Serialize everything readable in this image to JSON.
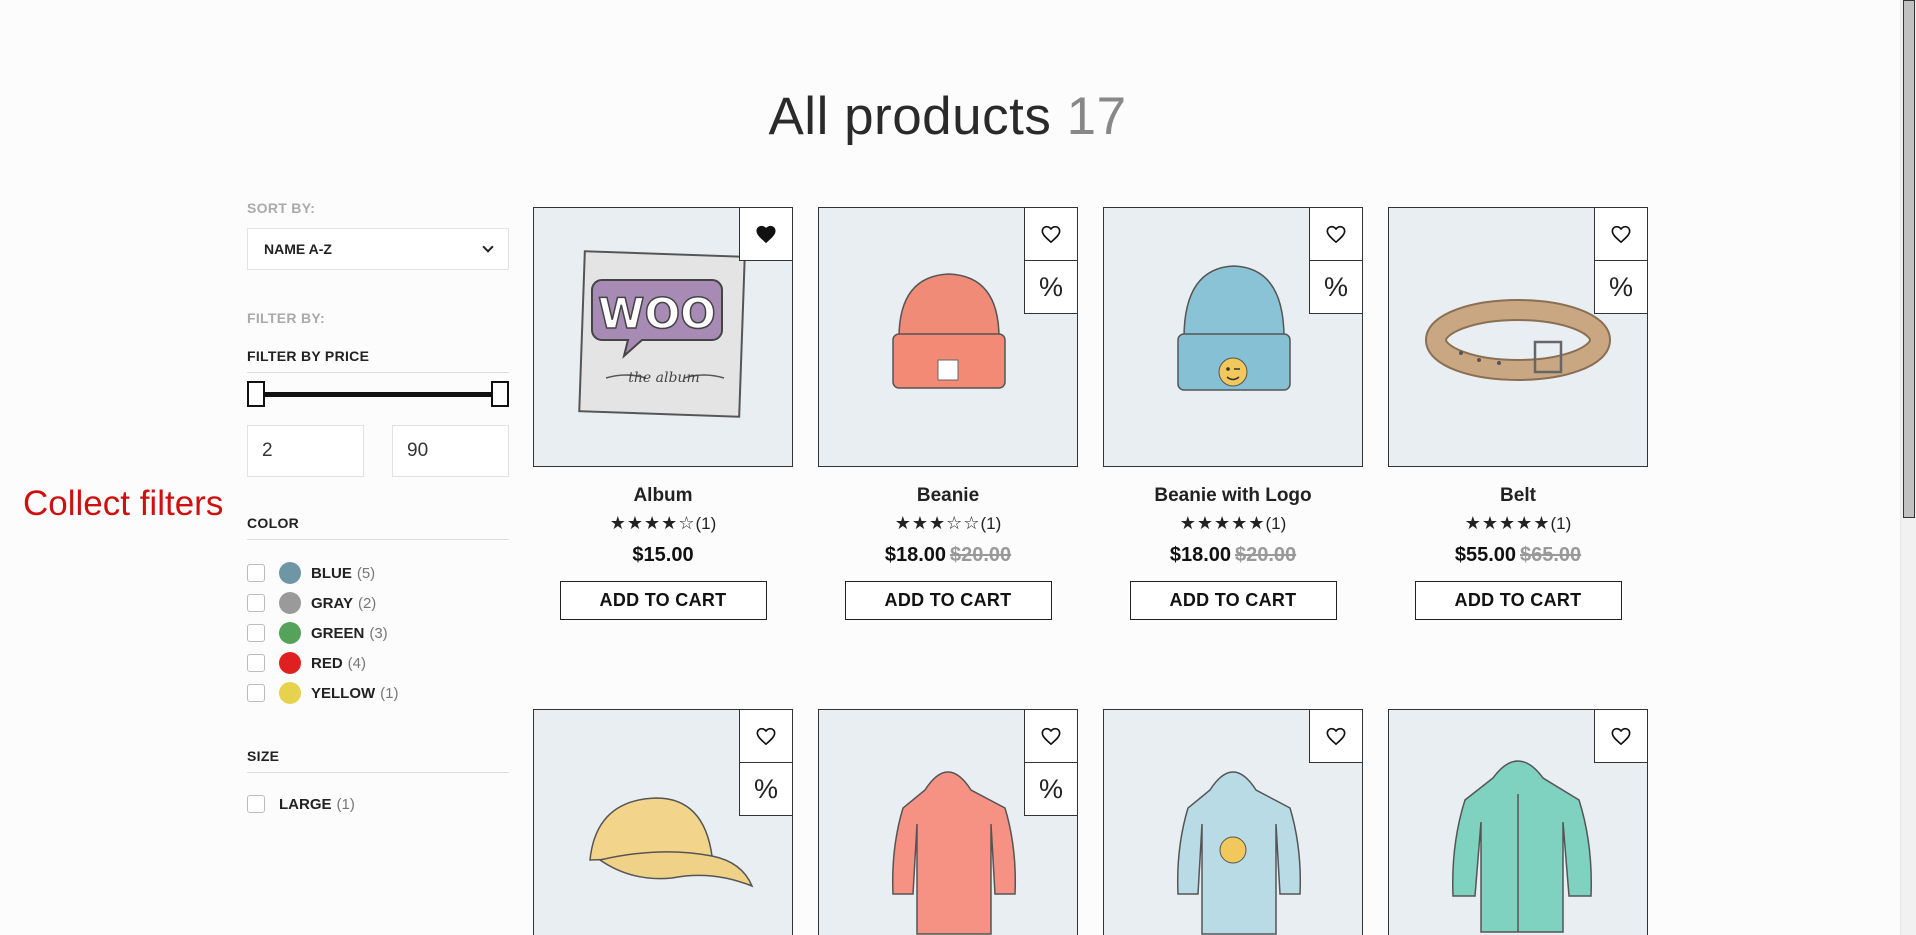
{
  "header": {
    "title": "All products",
    "count": "17"
  },
  "annotation": "Collect filters",
  "sidebar": {
    "sort_label": "SORT BY:",
    "sort_value": "NAME A-Z",
    "filter_label": "FILTER BY:",
    "price_title": "FILTER BY PRICE",
    "price_min": "2",
    "price_max": "90",
    "color_title": "COLOR",
    "colors": [
      {
        "name": "BLUE",
        "count": "(5)",
        "hex": "#6f96a4"
      },
      {
        "name": "GRAY",
        "count": "(2)",
        "hex": "#9a9a9a"
      },
      {
        "name": "GREEN",
        "count": "(3)",
        "hex": "#55a35a"
      },
      {
        "name": "RED",
        "count": "(4)",
        "hex": "#e02020"
      },
      {
        "name": "YELLOW",
        "count": "(1)",
        "hex": "#e6d24d"
      }
    ],
    "size_title": "SIZE",
    "sizes": [
      {
        "name": "LARGE",
        "count": "(1)"
      }
    ]
  },
  "products": [
    {
      "name": "Album",
      "stars": "★★★★☆",
      "rating_count": "(1)",
      "price": "$15.00",
      "old_price": "",
      "add_label": "ADD TO CART",
      "wishlisted": true,
      "on_sale": false
    },
    {
      "name": "Beanie",
      "stars": "★★★☆☆",
      "rating_count": "(1)",
      "price": "$18.00",
      "old_price": "$20.00",
      "add_label": "ADD TO CART",
      "wishlisted": false,
      "on_sale": true
    },
    {
      "name": "Beanie with Logo",
      "stars": "★★★★★",
      "rating_count": "(1)",
      "price": "$18.00",
      "old_price": "$20.00",
      "add_label": "ADD TO CART",
      "wishlisted": false,
      "on_sale": true
    },
    {
      "name": "Belt",
      "stars": "★★★★★",
      "rating_count": "(1)",
      "price": "$55.00",
      "old_price": "$65.00",
      "add_label": "ADD TO CART",
      "wishlisted": false,
      "on_sale": true
    },
    {
      "name": "",
      "wishlisted": false,
      "on_sale": true
    },
    {
      "name": "",
      "wishlisted": false,
      "on_sale": true
    },
    {
      "name": "",
      "wishlisted": false,
      "on_sale": false
    },
    {
      "name": "",
      "wishlisted": false,
      "on_sale": false
    }
  ],
  "icons": {
    "wishlist": "heart-icon",
    "sale": "percent-icon",
    "sort": "chevron-down-icon"
  }
}
